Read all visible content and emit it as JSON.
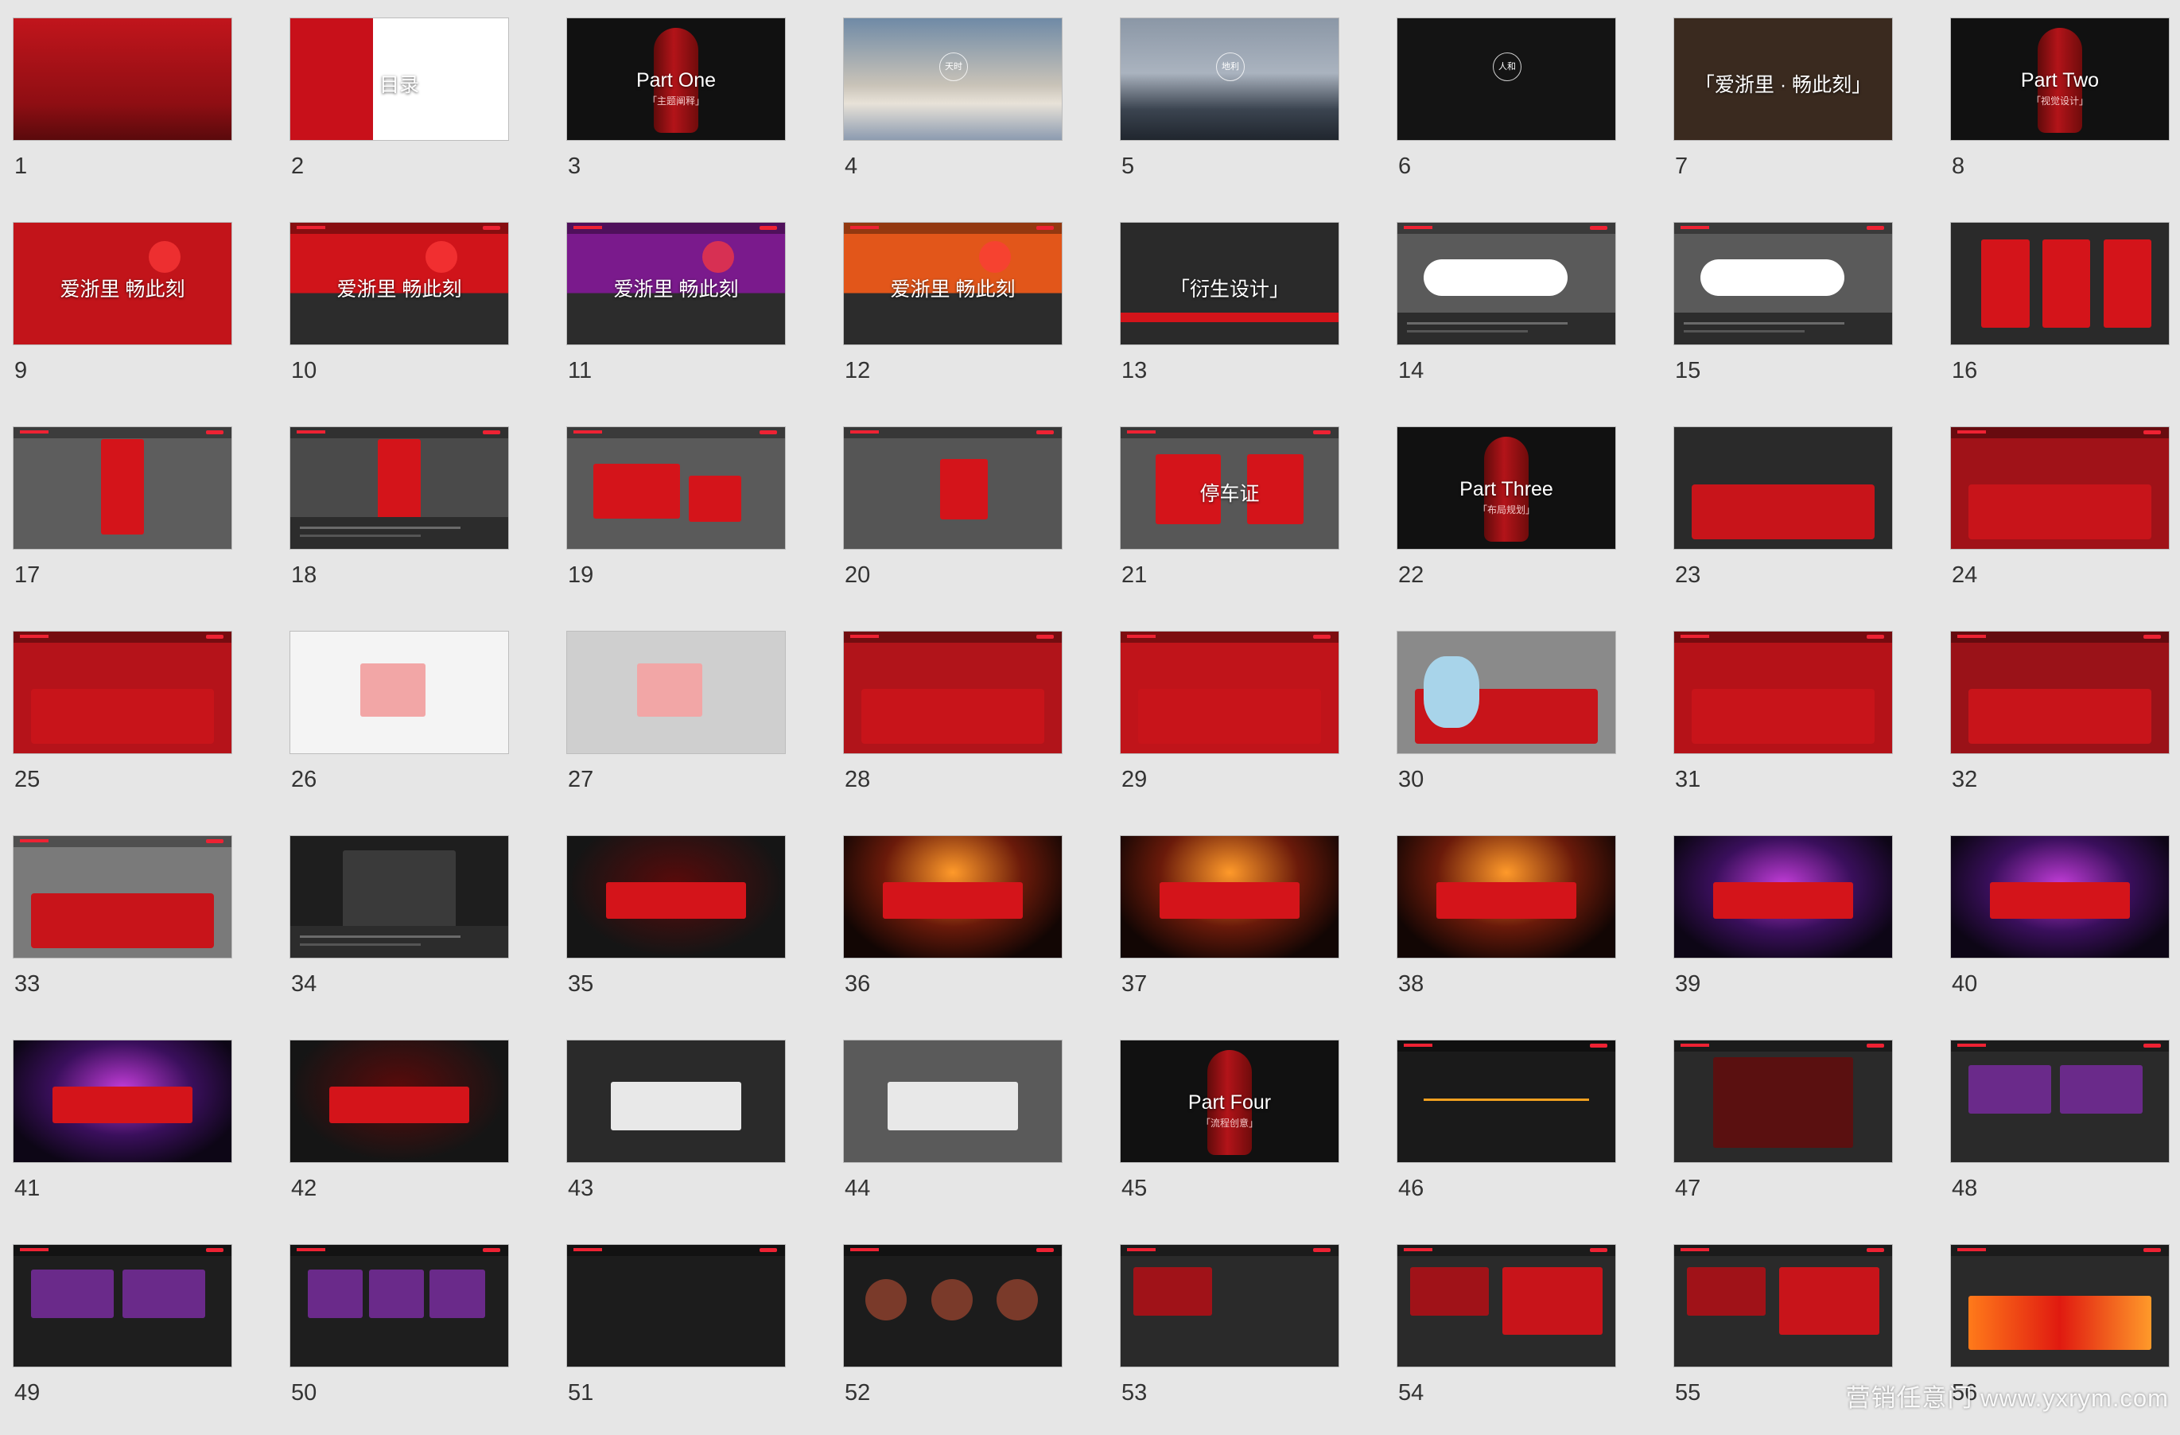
{
  "slides": [
    {
      "n": "1",
      "bg": "#b3131b",
      "style": "cover",
      "title": "",
      "caption": ""
    },
    {
      "n": "2",
      "bg": "#c8101a",
      "style": "content",
      "title": "目录",
      "caption": ""
    },
    {
      "n": "3",
      "bg": "#111111",
      "style": "part",
      "title": "Part One",
      "caption": "「主题阐释」"
    },
    {
      "n": "4",
      "bg": "#7d8fa5",
      "style": "sky",
      "title": "天时",
      "caption": ""
    },
    {
      "n": "5",
      "bg": "#6d7886",
      "style": "sky",
      "title": "地利",
      "caption": ""
    },
    {
      "n": "6",
      "bg": "#141414",
      "style": "dark-circle",
      "title": "人和",
      "caption": ""
    },
    {
      "n": "7",
      "bg": "#3a2a1f",
      "style": "concert",
      "title": "「爱浙里 · 畅此刻」",
      "caption": ""
    },
    {
      "n": "8",
      "bg": "#111111",
      "style": "part",
      "title": "Part Two",
      "caption": "「视觉设计」"
    },
    {
      "n": "9",
      "bg": "#c2141a",
      "style": "kv",
      "title": "爱浙里 畅此刻",
      "caption": ""
    },
    {
      "n": "10",
      "bg": "#d0141a",
      "style": "kv-bar",
      "title": "爱浙里 畅此刻",
      "caption": ""
    },
    {
      "n": "11",
      "bg": "#7a1a8c",
      "style": "kv-bar",
      "title": "爱浙里 畅此刻",
      "caption": ""
    },
    {
      "n": "12",
      "bg": "#e2561a",
      "style": "kv-bar",
      "title": "爱浙里 畅此刻",
      "caption": ""
    },
    {
      "n": "13",
      "bg": "#2a2a2a",
      "style": "dark-red",
      "title": "「衍生设计」",
      "caption": ""
    },
    {
      "n": "14",
      "bg": "#5a5a5a",
      "style": "bottle-h",
      "title": "",
      "caption": ""
    },
    {
      "n": "15",
      "bg": "#5a5a5a",
      "style": "bottle-h",
      "title": "",
      "caption": ""
    },
    {
      "n": "16",
      "bg": "#2a2a2a",
      "style": "cards",
      "title": "",
      "caption": ""
    },
    {
      "n": "17",
      "bg": "#5d5d5d",
      "style": "standee",
      "title": "",
      "caption": ""
    },
    {
      "n": "18",
      "bg": "#4a4a4a",
      "style": "easel",
      "title": "",
      "caption": ""
    },
    {
      "n": "19",
      "bg": "#5a5a5a",
      "style": "boxes",
      "title": "",
      "caption": ""
    },
    {
      "n": "20",
      "bg": "#555555",
      "style": "badge",
      "title": "",
      "caption": ""
    },
    {
      "n": "21",
      "bg": "#575757",
      "style": "permit",
      "title": "停车证",
      "caption": ""
    },
    {
      "n": "22",
      "bg": "#111111",
      "style": "part",
      "title": "Part Three",
      "caption": "「布局规划」"
    },
    {
      "n": "23",
      "bg": "#2a2a2a",
      "style": "venue",
      "title": "",
      "caption": ""
    },
    {
      "n": "24",
      "bg": "#a01218",
      "style": "venue-red",
      "title": "",
      "caption": ""
    },
    {
      "n": "25",
      "bg": "#b5131a",
      "style": "stairs",
      "title": "",
      "caption": ""
    },
    {
      "n": "26",
      "bg": "#f4f4f4",
      "style": "plan",
      "title": "",
      "caption": ""
    },
    {
      "n": "27",
      "bg": "#cfcfcf",
      "style": "plan3d",
      "title": "",
      "caption": ""
    },
    {
      "n": "28",
      "bg": "#b1141a",
      "style": "hall",
      "title": "",
      "caption": ""
    },
    {
      "n": "29",
      "bg": "#c0141a",
      "style": "hall",
      "title": "",
      "caption": ""
    },
    {
      "n": "30",
      "bg": "#8a8a8a",
      "style": "bear",
      "title": "",
      "caption": ""
    },
    {
      "n": "31",
      "bg": "#b51218",
      "style": "booth",
      "title": "",
      "caption": ""
    },
    {
      "n": "32",
      "bg": "#9a1218",
      "style": "booth",
      "title": "",
      "caption": ""
    },
    {
      "n": "33",
      "bg": "#7a7a7a",
      "style": "hall",
      "title": "",
      "caption": ""
    },
    {
      "n": "34",
      "bg": "#1e1e1e",
      "style": "seating",
      "title": "",
      "caption": ""
    },
    {
      "n": "35",
      "bg": "#141414",
      "style": "stage",
      "title": "",
      "caption": ""
    },
    {
      "n": "36",
      "bg": "#1a0c08",
      "style": "stage-light",
      "title": "",
      "caption": ""
    },
    {
      "n": "37",
      "bg": "#1c0c08",
      "style": "stage-light",
      "title": "",
      "caption": ""
    },
    {
      "n": "38",
      "bg": "#1c0a08",
      "style": "stage-light",
      "title": "",
      "caption": ""
    },
    {
      "n": "39",
      "bg": "#140a1c",
      "style": "stage-purple",
      "title": "",
      "caption": ""
    },
    {
      "n": "40",
      "bg": "#120a1e",
      "style": "stage-purple",
      "title": "",
      "caption": ""
    },
    {
      "n": "41",
      "bg": "#120a1e",
      "style": "stage-purple",
      "title": "",
      "caption": ""
    },
    {
      "n": "42",
      "bg": "#141414",
      "style": "stage",
      "title": "",
      "caption": ""
    },
    {
      "n": "43",
      "bg": "#2a2a2a",
      "style": "gray-stage",
      "title": "",
      "caption": ""
    },
    {
      "n": "44",
      "bg": "#5a5a5a",
      "style": "gray-stage",
      "title": "",
      "caption": ""
    },
    {
      "n": "45",
      "bg": "#111111",
      "style": "part",
      "title": "Part Four",
      "caption": "「流程创意」"
    },
    {
      "n": "46",
      "bg": "#1a1a1a",
      "style": "timeline",
      "title": "",
      "caption": ""
    },
    {
      "n": "47",
      "bg": "#2a2a2a",
      "style": "table",
      "title": "",
      "caption": ""
    },
    {
      "n": "48",
      "bg": "#2a2a2a",
      "style": "text-photo",
      "title": "",
      "caption": ""
    },
    {
      "n": "49",
      "bg": "#1e1e1e",
      "style": "photos",
      "title": "",
      "caption": ""
    },
    {
      "n": "50",
      "bg": "#1e1e1e",
      "style": "photos3",
      "title": "",
      "caption": ""
    },
    {
      "n": "51",
      "bg": "#1c1c1c",
      "style": "text",
      "title": "",
      "caption": ""
    },
    {
      "n": "52",
      "bg": "#1c1c1c",
      "style": "circles",
      "title": "",
      "caption": ""
    },
    {
      "n": "53",
      "bg": "#2a2a2a",
      "style": "redbox",
      "title": "",
      "caption": ""
    },
    {
      "n": "54",
      "bg": "#2a2a2a",
      "style": "redbox-stage",
      "title": "",
      "caption": ""
    },
    {
      "n": "55",
      "bg": "#2a2a2a",
      "style": "redbox-stage",
      "title": "",
      "caption": ""
    },
    {
      "n": "56",
      "bg": "#2a2a2a",
      "style": "fire",
      "title": "",
      "caption": ""
    }
  ],
  "watermark": "营销任意门 www.yxrym.com"
}
